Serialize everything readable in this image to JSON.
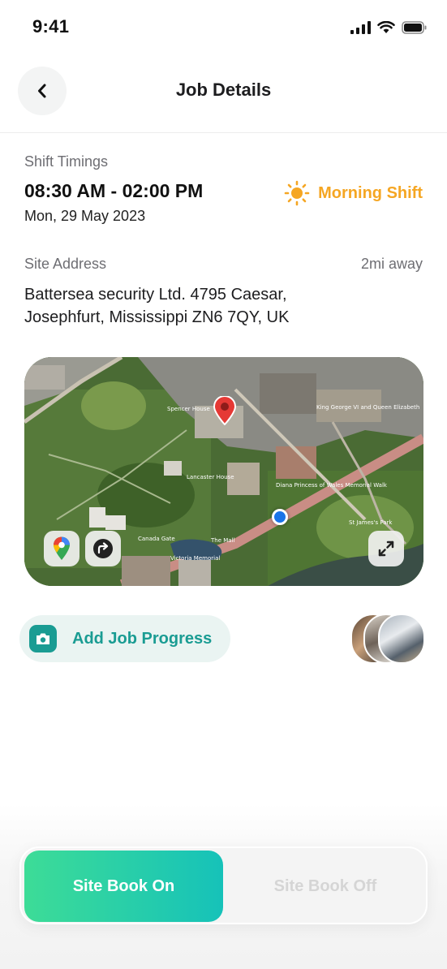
{
  "status_bar": {
    "time": "9:41"
  },
  "header": {
    "title": "Job Details"
  },
  "shift": {
    "label": "Shift Timings",
    "time": "08:30 AM - 02:00 PM",
    "date": "Mon, 29 May 2023",
    "badge": "Morning Shift",
    "badge_color": "#f5a623"
  },
  "site": {
    "label": "Site Address",
    "distance": "2mi away",
    "address": "Battersea security Ltd. 4795 Caesar, Josephfurt, Mississippi ZN6 7QY, UK"
  },
  "map": {
    "type": "satellite",
    "labels": {
      "spencer_house": "Spencer House",
      "lancaster_house": "Lancaster House",
      "canada_gate": "Canada Gate",
      "victoria_memorial": "Victoria Memorial",
      "the_mall": "The Mall",
      "diana_memorial": "Diana Princess of Wales Memorial Walk",
      "george_vi": "King George VI and Queen Elizabeth",
      "st_james_park": "St James's Park"
    }
  },
  "job_progress": {
    "label": "Add Job Progress",
    "accent": "#1a9c93"
  },
  "toggle": {
    "on_label": "Site Book On",
    "off_label": "Site Book Off",
    "active": "on"
  },
  "icons": {
    "back": "chevron-left-icon",
    "shift": "sun-icon",
    "maps": "google-maps-icon",
    "directions": "directions-icon",
    "expand": "expand-icon",
    "camera": "camera-icon"
  }
}
